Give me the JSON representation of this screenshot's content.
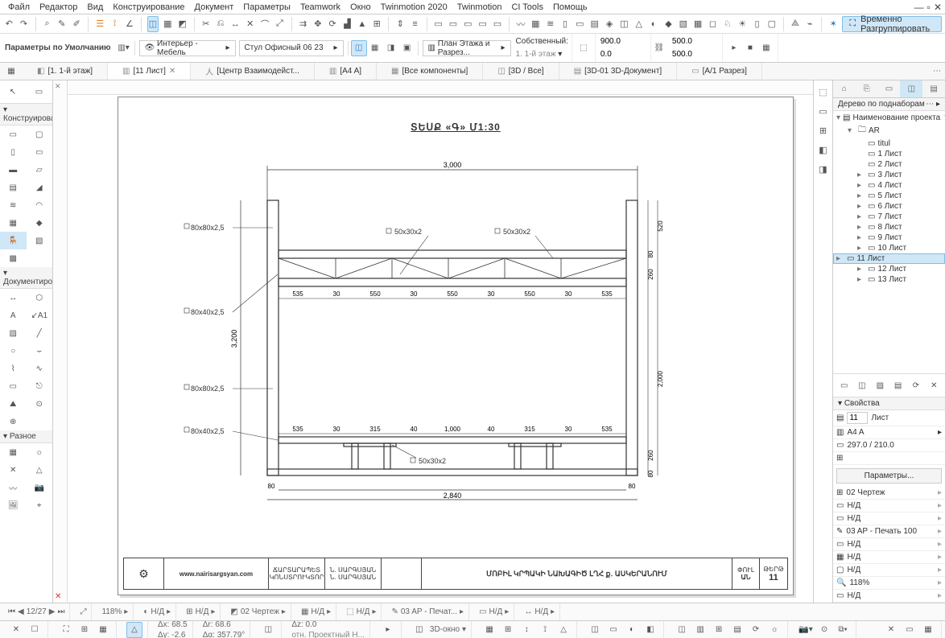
{
  "menu": [
    "Файл",
    "Редактор",
    "Вид",
    "Конструирование",
    "Документ",
    "Параметры",
    "Teamwork",
    "Окно",
    "Twinmotion 2020",
    "Twinmotion",
    "CI Tools",
    "Помощь"
  ],
  "ungroup_btn": "Временно Разгруппировать",
  "infobar": {
    "label": "Параметры по Умолчанию",
    "layer": "Интерьер - Мебель",
    "object": "Стул Офисный 06 23",
    "tab_group": "План Этажа и Разрез...",
    "height_label": "Собственный:",
    "floor": "1. 1-й этаж",
    "x1": "900.0",
    "y1": "500.0",
    "x2": "0.0",
    "y2": "500.0"
  },
  "tabs": [
    {
      "icon": "◧",
      "label": "[1. 1-й этаж]",
      "act": false
    },
    {
      "icon": "▥",
      "label": "[11 Лист]",
      "act": true,
      "closable": true
    },
    {
      "icon": "人",
      "label": "[Центр Взаимодейст...",
      "act": false
    },
    {
      "icon": "▥",
      "label": "[A4 A]",
      "act": false
    },
    {
      "icon": "▦",
      "label": "[Все компоненты]",
      "act": false
    },
    {
      "icon": "◫",
      "label": "[3D / Все]",
      "act": false
    },
    {
      "icon": "▤",
      "label": "[3D-01 3D-Документ]",
      "act": false
    },
    {
      "icon": "▭",
      "label": "[A/1 Разрез]",
      "act": false
    }
  ],
  "toolbox": {
    "s1": "Конструирова",
    "s2": "Документиро",
    "s3": "Разное"
  },
  "tree": {
    "title": "Дерево по поднаборам",
    "root": "Наименование проекта",
    "folder": "AR",
    "items": [
      "titul",
      "1 Лист",
      "2 Лист",
      "3 Лист",
      "4 Лист",
      "5 Лист",
      "6 Лист",
      "7 Лист",
      "8 Лист",
      "9 Лист",
      "10 Лист",
      "11 Лист",
      "12 Лист",
      "13 Лист"
    ]
  },
  "props": {
    "title": "Свойства",
    "id": "11",
    "id_label": "Лист",
    "master": "A4 A",
    "size": "297.0 / 210.0",
    "params_btn": "Параметры...",
    "below": [
      "02 Чертеж",
      "Н/Д",
      "Н/Д",
      "03 AP - Печать 100",
      "Н/Д",
      "Н/Д",
      "Н/Д",
      "118%",
      "Н/Д"
    ]
  },
  "drawing": {
    "title": "ՏԵՍՔ «Գ»  Մ1:30",
    "top_dim": "3,000",
    "annot1": "80x80x2,5",
    "annot2": "80x40x2,5",
    "annot3": "80x80x2,5",
    "annot4": "80x40x2,5",
    "lab_top1": "50x30x2",
    "lab_top2": "50x30x2",
    "lab_bot": "50x30x2",
    "v_left": "3,200",
    "v_right1": "520",
    "v_right2": "260",
    "v_right3": "2,000",
    "v_right4": "260",
    "bot_dim": "2,840",
    "bot_80l": "80",
    "bot_80r": "80",
    "mid_80t": "80",
    "mid_80b": "80",
    "row_top": [
      "535",
      "30",
      "550",
      "30",
      "550",
      "30",
      "550",
      "30",
      "535"
    ],
    "row_bot": [
      "535",
      "30",
      "315",
      "40",
      "1,000",
      "40",
      "315",
      "30",
      "535"
    ]
  },
  "titlebox": {
    "role1": "ՃԱՐՏԱՐԱՊԵՏ",
    "role2": "ԿՈՆՍՏՐՈՒԿՏՈՐ",
    "name": "Ն. ՍԱՐԳՍՅԱՆ",
    "web": "www.nairisargsyan.com",
    "project": "ՄՈԲԻԼ ԿՐՊԱԿԻ ՆԱԽԱԳԻԾ ԼՂՀ ք․ ԱՍԿԵՐԱՆՈՒՄ",
    "col1": "ՓՈՒԼ",
    "col1v": "ԱՆ",
    "col2": "ԹԵՐԹ",
    "col2v": "11"
  },
  "status1": {
    "page": "12/27",
    "zoom": "118%",
    "nd": "Н/Д",
    "layer": "02 Чертеж",
    "pen": "03 AP - Печат..."
  },
  "status2": {
    "dx": "Δx: 68.5",
    "dy": "Δy: -2.6",
    "dz": "Δz: 0.0",
    "dr": "Δr: 68.6",
    "da": "Δα: 357.79°",
    "note": "отн. Проектный Н...",
    "btn3d": "3D-окно"
  }
}
